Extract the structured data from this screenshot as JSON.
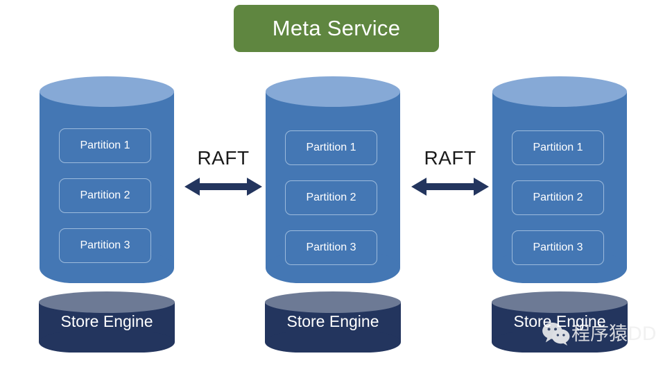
{
  "diagram": {
    "title": "Meta Service",
    "meta_service": {
      "label": "Meta Service",
      "color": "#5f8640"
    },
    "nodes": [
      {
        "id": "node-1",
        "store_engine_label": "Store Engine",
        "partitions": [
          {
            "label": "Partition 1"
          },
          {
            "label": "Partition 2"
          },
          {
            "label": "Partition 3"
          }
        ]
      },
      {
        "id": "node-2",
        "store_engine_label": "Store Engine",
        "partitions": [
          {
            "label": "Partition 1"
          },
          {
            "label": "Partition 2"
          },
          {
            "label": "Partition 3"
          }
        ]
      },
      {
        "id": "node-3",
        "store_engine_label": "Store Engine",
        "partitions": [
          {
            "label": "Partition 1"
          },
          {
            "label": "Partition 2"
          },
          {
            "label": "Partition 3"
          }
        ]
      }
    ],
    "connectors": [
      {
        "label": "RAFT",
        "icon": "double-headed-arrow-icon"
      },
      {
        "label": "RAFT",
        "icon": "double-headed-arrow-icon"
      }
    ],
    "colors": {
      "meta_service": "#5f8640",
      "cylinder_body": "#4477b4",
      "cylinder_top": "#86a9d6",
      "store_body": "#23355e",
      "store_top": "#6d7a95",
      "arrow": "#23355e",
      "partition_border": "#9dbbdc",
      "background": "#ffffff"
    }
  },
  "watermark": {
    "text": "程序猿DD",
    "icon": "wechat-icon"
  }
}
